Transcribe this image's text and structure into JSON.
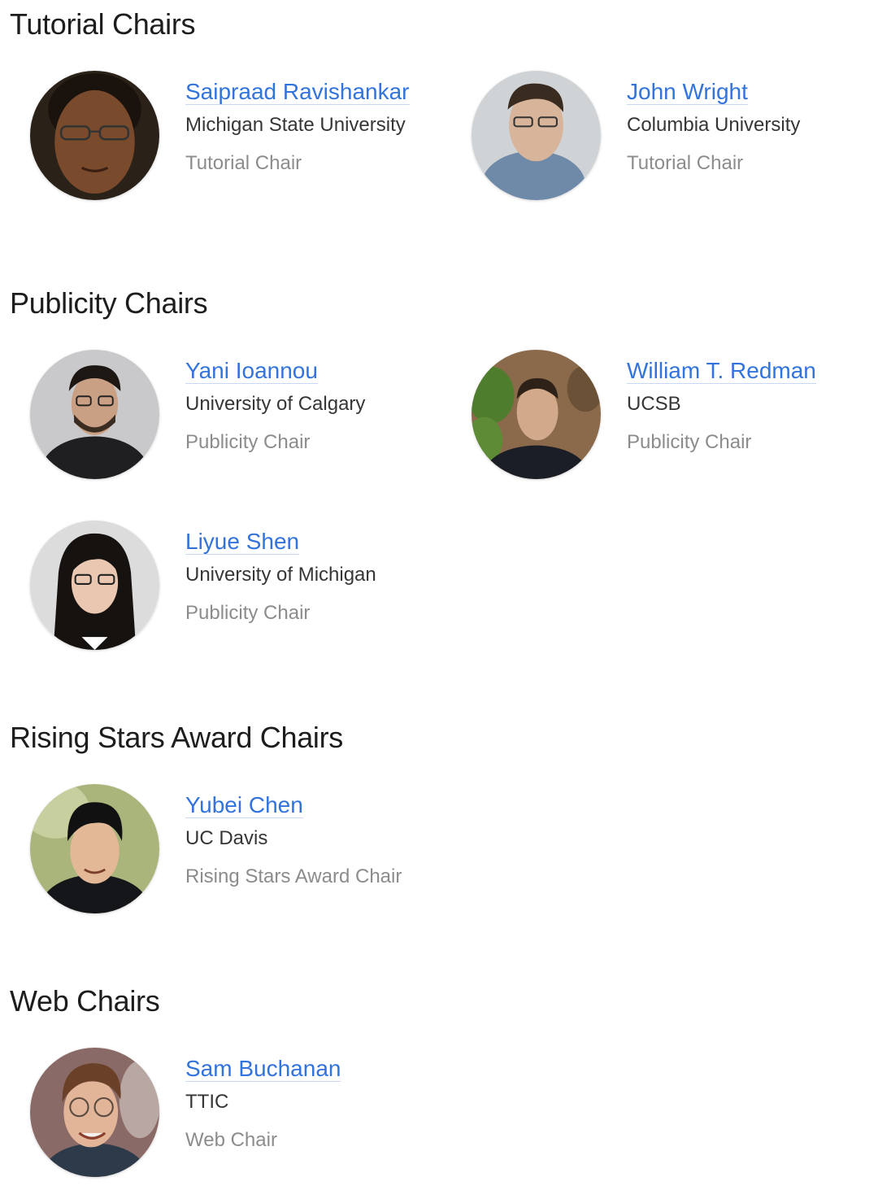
{
  "sections": {
    "tutorial": {
      "title": "Tutorial Chairs",
      "people": [
        {
          "name": "Saipraad Ravishankar",
          "org": "Michigan State University",
          "role": "Tutorial Chair"
        },
        {
          "name": "John Wright",
          "org": "Columbia University",
          "role": "Tutorial Chair"
        }
      ]
    },
    "publicity": {
      "title": "Publicity Chairs",
      "people": [
        {
          "name": "Yani Ioannou",
          "org": "University of Calgary",
          "role": "Publicity Chair"
        },
        {
          "name": "William T. Redman",
          "org": "UCSB",
          "role": "Publicity Chair"
        },
        {
          "name": "Liyue Shen",
          "org": "University of Michigan",
          "role": "Publicity Chair"
        }
      ]
    },
    "rising": {
      "title": "Rising Stars Award Chairs",
      "people": [
        {
          "name": "Yubei Chen",
          "org": "UC Davis",
          "role": "Rising Stars Award Chair"
        }
      ]
    },
    "web": {
      "title": "Web Chairs",
      "people": [
        {
          "name": "Sam Buchanan",
          "org": "TTIC",
          "role": "Web Chair"
        }
      ]
    }
  },
  "colors": {
    "link": "#3273dc",
    "org_text": "#363636",
    "role_text": "#8c8c8c",
    "heading": "#1d1d1f"
  }
}
